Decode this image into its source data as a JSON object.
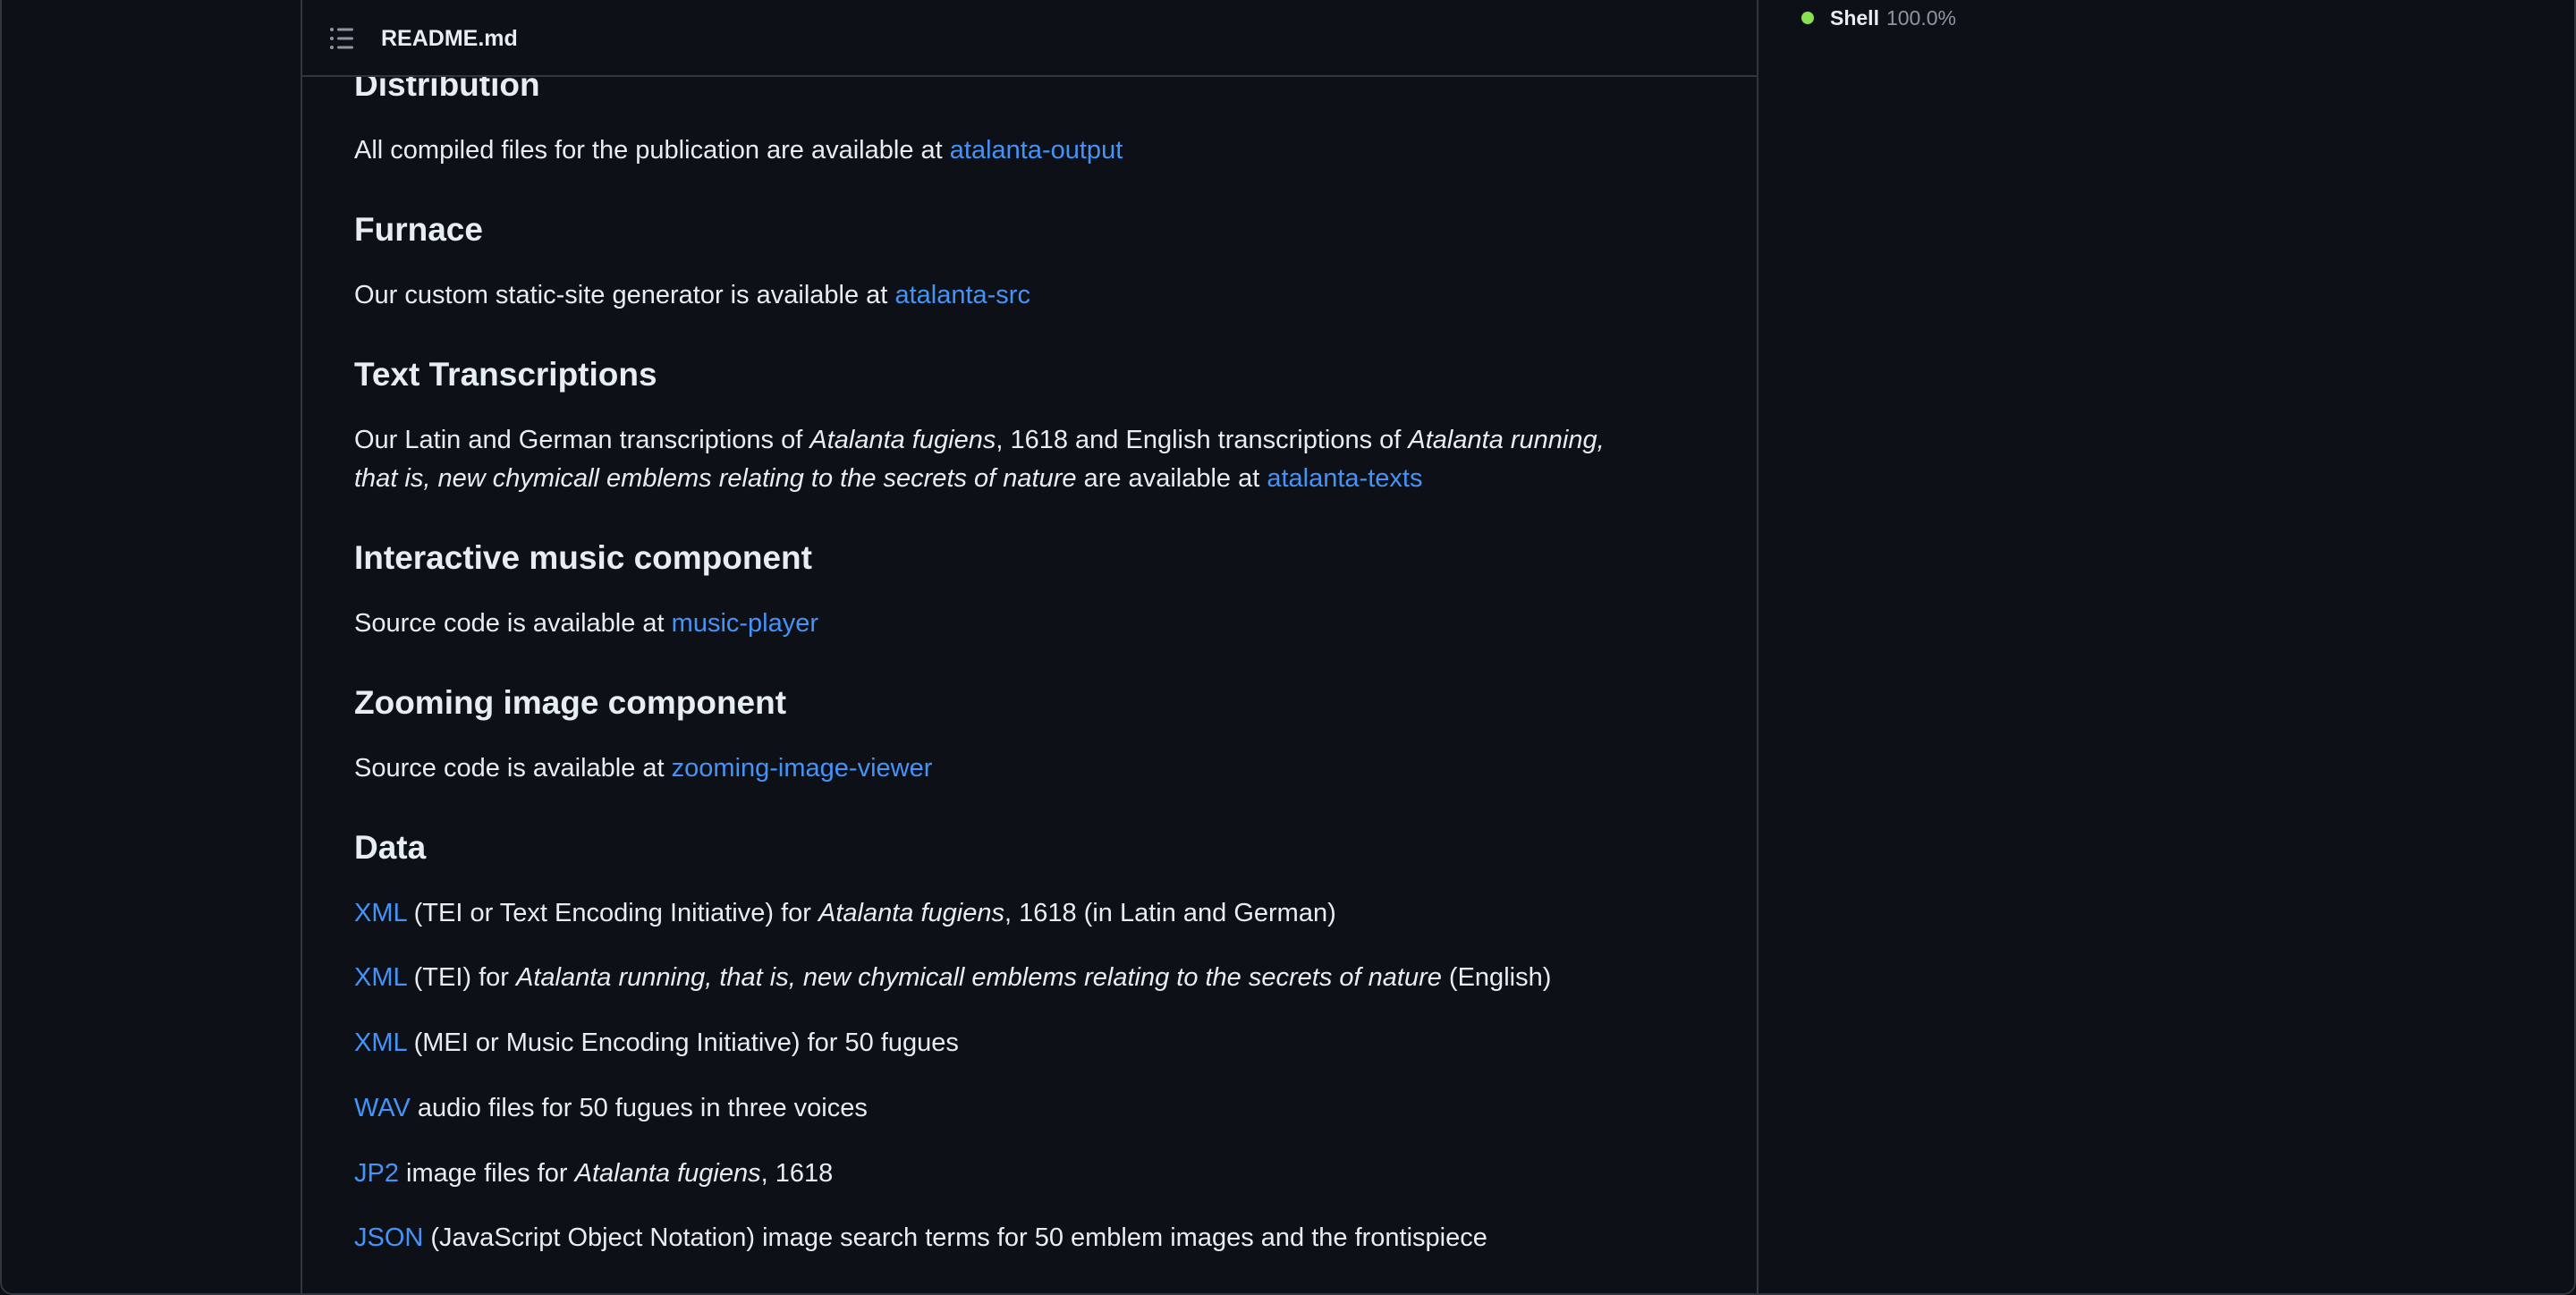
{
  "readme": {
    "filename": "README.md",
    "toc_icon": "list-unordered-icon"
  },
  "languages": {
    "dot_color": "#89e051",
    "name": "Shell",
    "percent": "100.0%"
  },
  "sections": {
    "distribution": {
      "heading": "Distribution",
      "text": "All compiled files for the publication are available at ",
      "link": "atalanta-output"
    },
    "furnace": {
      "heading": "Furnace",
      "text": "Our custom static-site generator is available at ",
      "link": "atalanta-src"
    },
    "transcriptions": {
      "heading": "Text Transcriptions",
      "line1_a": "Our Latin and German transcriptions of ",
      "line1_em1": "Atalanta fugiens",
      "line1_b": ", 1618 and English transcriptions of ",
      "line1_em2": "Atalanta running,",
      "line2_em": "that is, new chymicall emblems relating to the secrets of nature",
      "line2_b": " are available at ",
      "link": "atalanta-texts"
    },
    "music": {
      "heading": "Interactive music component",
      "text": "Source code is available at ",
      "link": "music-player"
    },
    "zoom": {
      "heading": "Zooming image component",
      "text": "Source code is available at ",
      "link": "zooming-image-viewer"
    },
    "data": {
      "heading": "Data",
      "item1_link": "XML",
      "item1_a": " (TEI or Text Encoding Initiative) for ",
      "item1_em": "Atalanta fugiens",
      "item1_b": ", 1618 (in Latin and German)",
      "item2_link": "XML",
      "item2_a": " (TEI) for ",
      "item2_em": "Atalanta running, that is, new chymicall emblems relating to the secrets of nature",
      "item2_b": " (English)",
      "item3_link": "XML",
      "item3_a": " (MEI or Music Encoding Initiative) for 50 fugues",
      "item4_link": "WAV",
      "item4_a": " audio files for 50 fugues in three voices",
      "item5_link": "JP2",
      "item5_a": " image files for ",
      "item5_em": "Atalanta fugiens",
      "item5_b": ", 1618",
      "item6_link": "JSON",
      "item6_a": " (JavaScript Object Notation) image search terms for 50 emblem images and the frontispiece"
    }
  },
  "colors": {
    "background": "#0d1117",
    "border": "#30363d",
    "text": "#e6edf3",
    "link": "#4493f8",
    "muted": "#8d96a0"
  }
}
